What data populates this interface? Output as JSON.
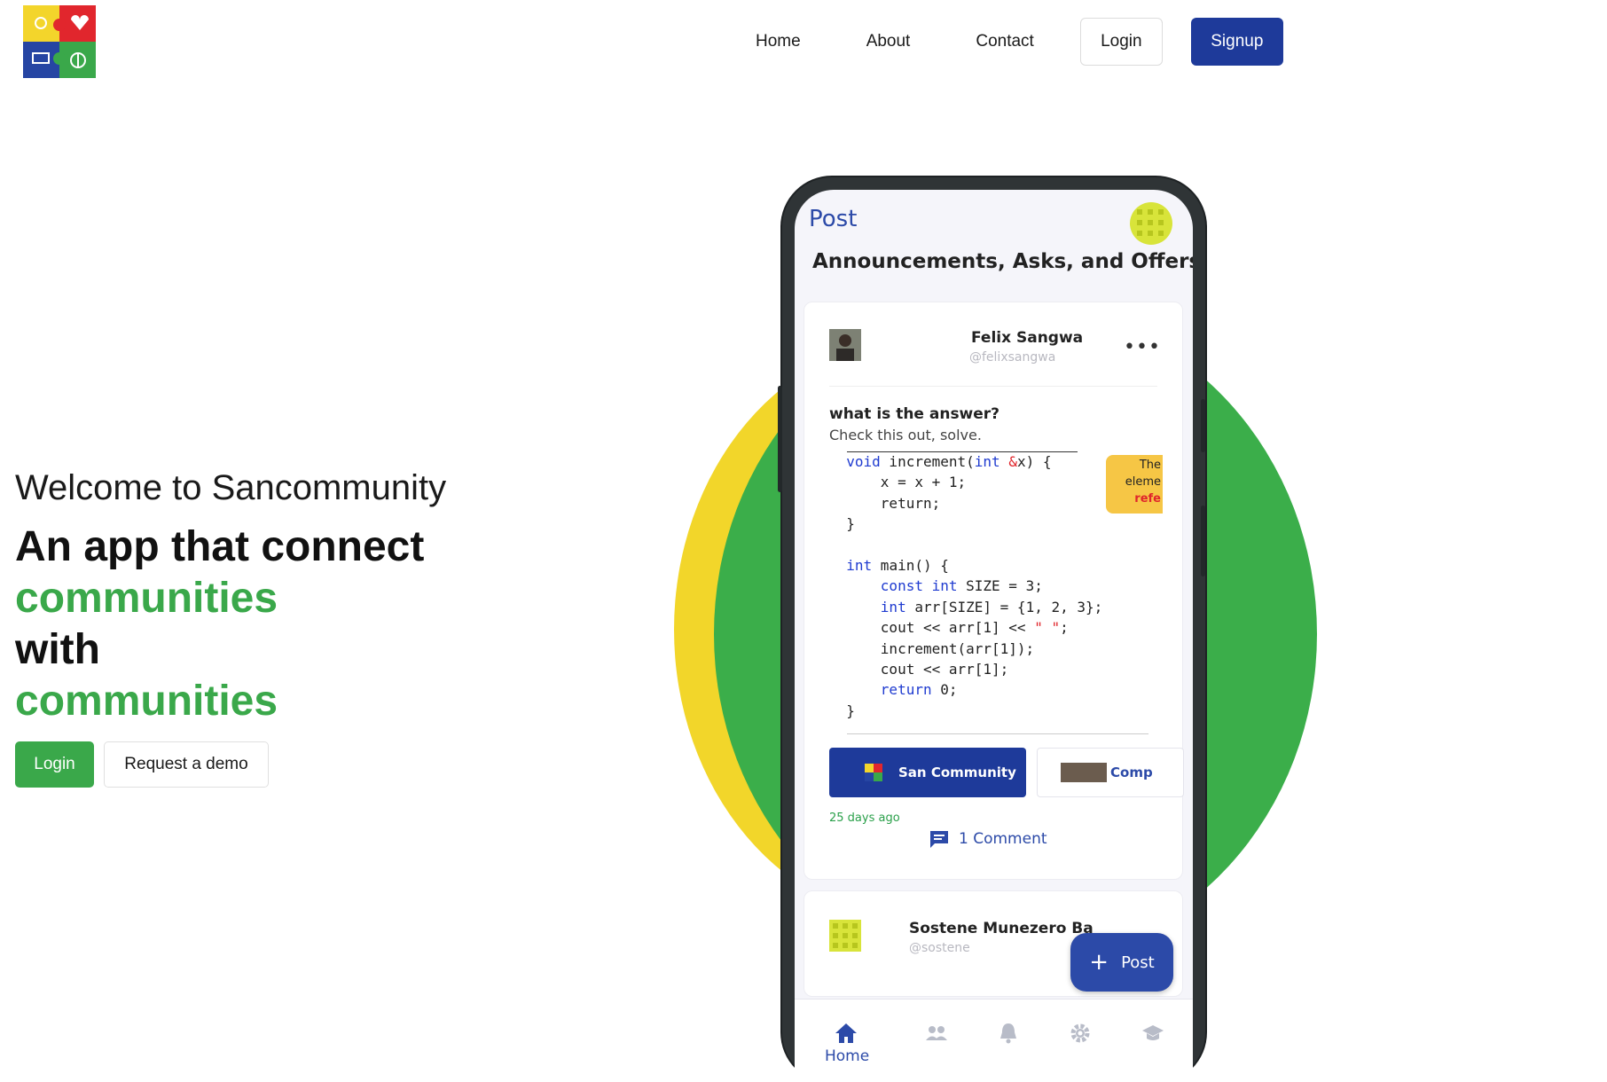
{
  "header": {
    "nav": [
      "Home",
      "About",
      "Contact"
    ],
    "login_label": "Login",
    "signup_label": "Signup"
  },
  "hero": {
    "welcome": "Welcome to Sancommunity",
    "line1": "An app that connect",
    "line2": "communities",
    "line3": "with",
    "line4": "communities",
    "login_label": "Login",
    "demo_label": "Request a demo"
  },
  "phone": {
    "title": "Post",
    "heading": "Announcements, Asks, and Offers",
    "post": {
      "author": "Felix Sangwa",
      "handle": "@felixsangwa",
      "more": "•••",
      "question": "what is the answer?",
      "subtitle": "Check this out, solve.",
      "tooltip": [
        "The",
        "eleme",
        "refe"
      ],
      "chip_primary": "San Community",
      "chip_secondary": "Comp",
      "time": "25 days ago",
      "comments": "1 Comment"
    },
    "post2": {
      "author": "Sostene Munezero Ba",
      "handle": "@sostene"
    },
    "fab_label": "Post",
    "bottom_nav": {
      "home_label": "Home",
      "icons": [
        "home-icon",
        "people-icon",
        "bell-icon",
        "gear-icon",
        "graduation-cap-icon"
      ]
    }
  },
  "colors": {
    "primary": "#1e3a9a",
    "accent_green": "#3aa84a",
    "yellow": "#f2d62a",
    "phone_blue": "#2c4aa8"
  }
}
